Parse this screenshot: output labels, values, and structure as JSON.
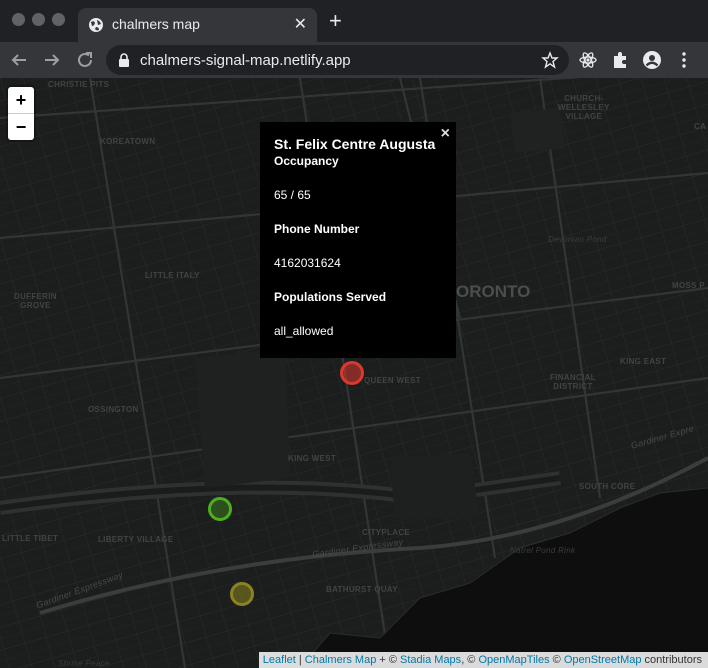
{
  "browser": {
    "tab_title": "chalmers map",
    "url": "chalmers-signal-map.netlify.app"
  },
  "map": {
    "zoom_in": "+",
    "zoom_out": "−",
    "labels": {
      "christie_pits": "CHRISTIE PITS",
      "church_wellesley": "CHURCH-\nWELLESLEY\nVILLAGE",
      "koreatown": "KOREATOWN",
      "devonian_pond": "Devonian Pond",
      "little_italy": "LITTLE ITALY",
      "dufferin_grove": "DUFFERIN\nGROVE",
      "toronto": "ORONTO",
      "moss_park": "MOSS P",
      "queen_west": "QUEEN WEST",
      "king_east": "KING EAST",
      "financial_district": "FINANCIAL\nDISTRICT",
      "ossington": "OSSINGTON",
      "king_west": "KING WEST",
      "gardiner_right": "Gardiner Expre",
      "south_core": "SOUTH CORE",
      "little_tibet": "LITTLE TIBET",
      "liberty_village": "LIBERTY VILLAGE",
      "cityplace": "CITYPLACE",
      "gardiner_mid": "Gardiner Expressway",
      "natrel_pond": "Natrel Pond Rink",
      "gardiner_left": "Gardiner Expressway",
      "bathurst_quay": "BATHURST QUAY",
      "shrine_peace": "Shrine Peace",
      "ca": "CA"
    },
    "markers": {
      "red": {
        "color": "#d9392f",
        "status": "full"
      },
      "green": {
        "color": "#4caf1f",
        "status": "available"
      },
      "yellow": {
        "color": "#8a8420",
        "status": "limited"
      }
    }
  },
  "popup": {
    "title": "St. Felix Centre Augusta",
    "occupancy_label": "Occupancy",
    "occupancy_value": "65 / 65",
    "phone_label": "Phone Number",
    "phone_value": "4162031624",
    "populations_label": "Populations Served",
    "populations_value": "all_allowed",
    "close": "×"
  },
  "attribution": {
    "leaflet": "Leaflet",
    "sep1": " | ",
    "chalmers": "Chalmers Map",
    "plus": " + © ",
    "stadia": "Stadia Maps",
    "comma1": ", © ",
    "openmaptiles": "OpenMapTiles",
    "copy": " © ",
    "osm": "OpenStreetMap",
    "contributors": " contributors"
  },
  "colors": {
    "chrome_bg": "#202124",
    "toolbar_bg": "#35363a",
    "map_bg": "#1b1c1c",
    "link": "#0078a8"
  }
}
